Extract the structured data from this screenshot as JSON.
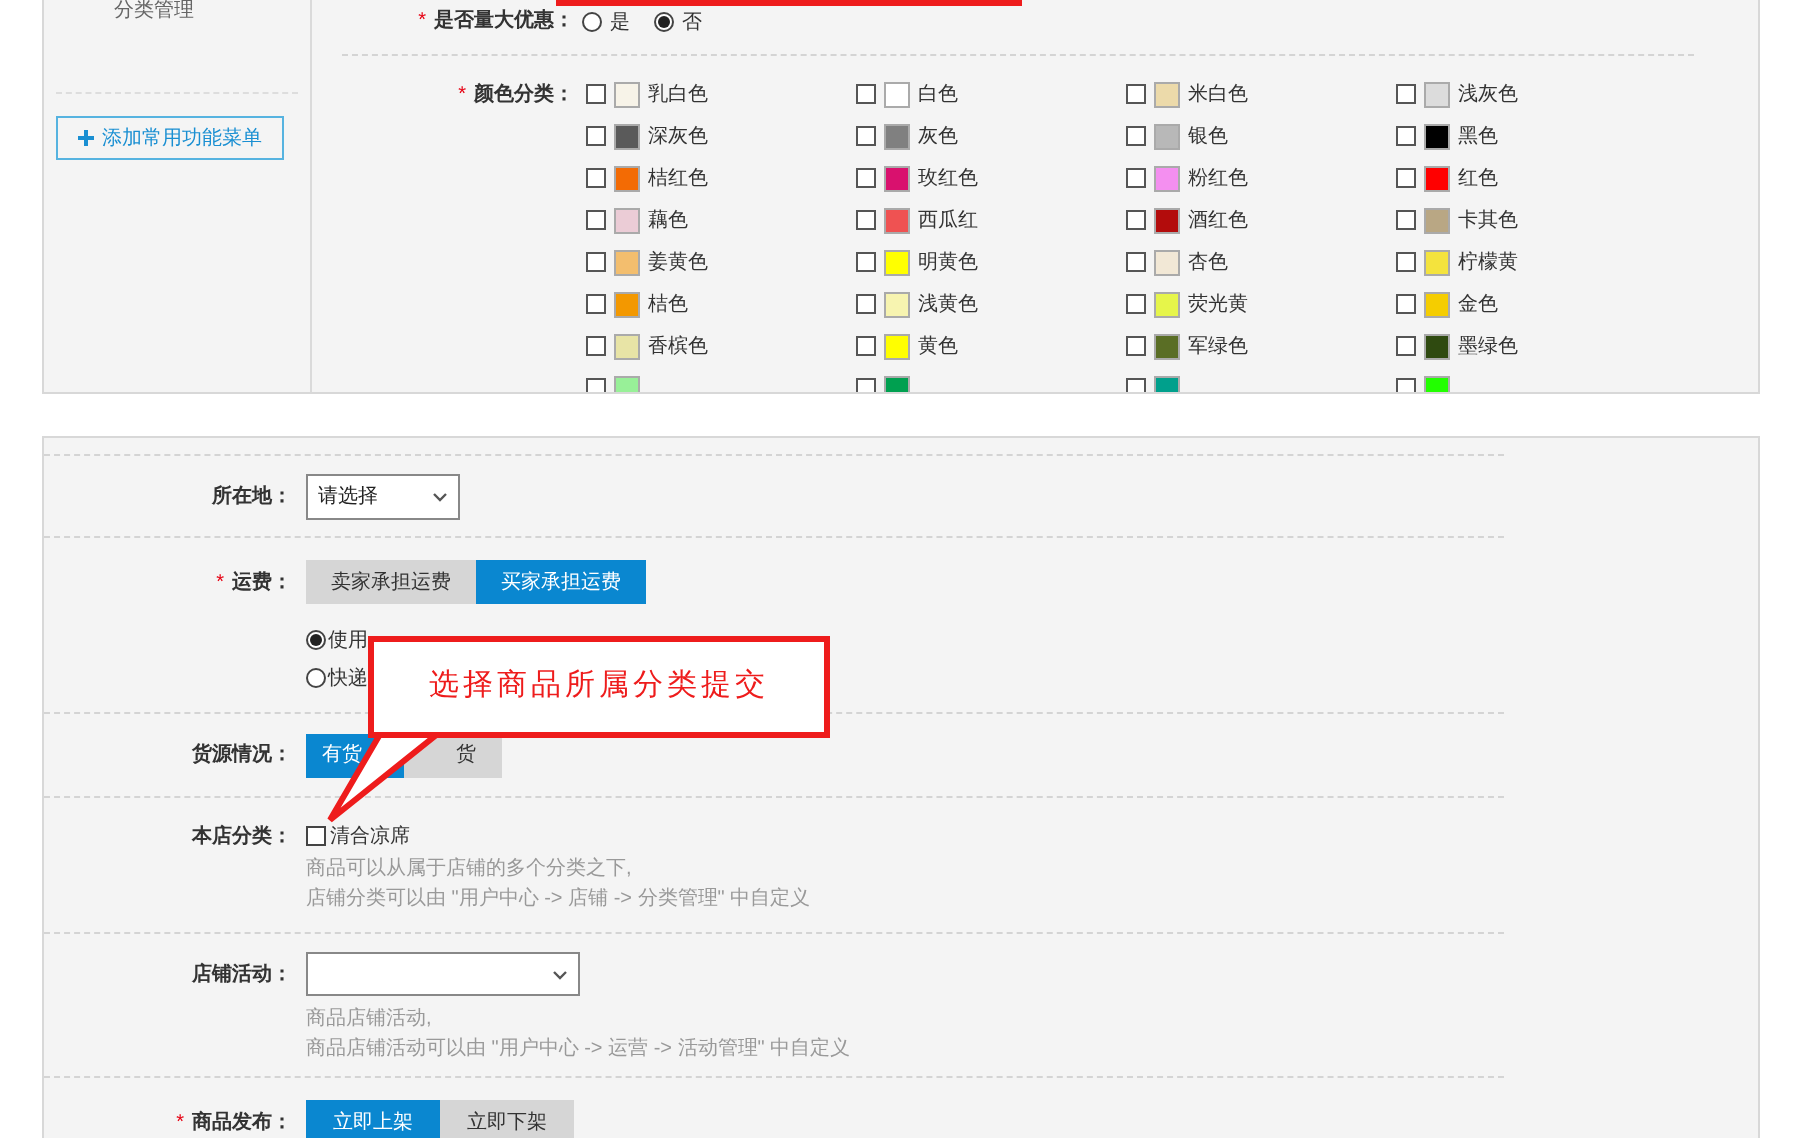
{
  "sidebar": {
    "items": [
      {
        "label": "分类管理"
      }
    ],
    "add_button": "添加常用功能菜单"
  },
  "discount": {
    "mark": "*",
    "label": "是否量大优惠：",
    "options": [
      {
        "label": "是",
        "selected": false
      },
      {
        "label": "否",
        "selected": true
      }
    ]
  },
  "colors": {
    "mark": "*",
    "label": "颜色分类：",
    "items": [
      {
        "name": "乳白色",
        "color": "#f7f3e8",
        "checked": false
      },
      {
        "name": "白色",
        "color": "#ffffff",
        "checked": false
      },
      {
        "name": "米白色",
        "color": "#ecdaaa",
        "checked": false
      },
      {
        "name": "浅灰色",
        "color": "#dcdcdc",
        "checked": false
      },
      {
        "name": "深灰色",
        "color": "#5a5a5a",
        "checked": false
      },
      {
        "name": "灰色",
        "color": "#808080",
        "checked": false
      },
      {
        "name": "银色",
        "color": "#b8b8b8",
        "checked": false
      },
      {
        "name": "黑色",
        "color": "#000000",
        "checked": false
      },
      {
        "name": "桔红色",
        "color": "#f36b04",
        "checked": false
      },
      {
        "name": "玫红色",
        "color": "#d9116e",
        "checked": false
      },
      {
        "name": "粉红色",
        "color": "#f48ff0",
        "checked": false
      },
      {
        "name": "红色",
        "color": "#ff0000",
        "checked": false
      },
      {
        "name": "藕色",
        "color": "#ebccd6",
        "checked": false
      },
      {
        "name": "西瓜红",
        "color": "#ef5252",
        "checked": false
      },
      {
        "name": "酒红色",
        "color": "#b30c0c",
        "checked": false
      },
      {
        "name": "卡其色",
        "color": "#b9a784",
        "checked": false
      },
      {
        "name": "姜黄色",
        "color": "#f3be6e",
        "checked": false
      },
      {
        "name": "明黄色",
        "color": "#ffff00",
        "checked": false
      },
      {
        "name": "杏色",
        "color": "#f2e8d6",
        "checked": false
      },
      {
        "name": "柠檬黄",
        "color": "#f4e33d",
        "checked": false
      },
      {
        "name": "桔色",
        "color": "#f39800",
        "checked": false
      },
      {
        "name": "浅黄色",
        "color": "#f7f4b0",
        "checked": false
      },
      {
        "name": "荧光黄",
        "color": "#e6f54a",
        "checked": false
      },
      {
        "name": "金色",
        "color": "#f5cd00",
        "checked": false
      },
      {
        "name": "香槟色",
        "color": "#e8e4a6",
        "checked": false
      },
      {
        "name": "黄色",
        "color": "#fffe00",
        "checked": false
      },
      {
        "name": "军绿色",
        "color": "#5a6e25",
        "checked": false
      },
      {
        "name": "墨绿色",
        "color": "#2f4a10",
        "checked": false
      },
      {
        "color": "#98f098",
        "checked": false
      },
      {
        "color": "#00a050",
        "checked": false
      },
      {
        "color": "#00a08c",
        "checked": false
      },
      {
        "color": "#22ff00",
        "checked": false
      }
    ]
  },
  "location": {
    "label": "所在地：",
    "value": "请选择"
  },
  "shipping": {
    "mark": "*",
    "label": "运费：",
    "options": [
      {
        "label": "卖家承担运费",
        "selected": false
      },
      {
        "label": "买家承担运费",
        "selected": true
      }
    ],
    "methods": [
      {
        "label": "使用",
        "selected": true
      },
      {
        "label": "快递",
        "selected": false
      }
    ]
  },
  "stock": {
    "label": "货源情况：",
    "options": [
      {
        "label": "有货",
        "selected": true
      },
      {
        "label": "货",
        "selected": false
      }
    ]
  },
  "shop_category": {
    "label": "本店分类：",
    "items": [
      {
        "label": "清合凉席",
        "checked": false
      }
    ],
    "hints": [
      "商品可以从属于店铺的多个分类之下,",
      "店铺分类可以由 \"用户中心 -> 店铺 -> 分类管理\" 中自定义"
    ]
  },
  "shop_activity": {
    "label": "店铺活动：",
    "hints": [
      "商品店铺活动,",
      "商品店铺活动可以由 \"用户中心 -> 运营 -> 活动管理\" 中自定义"
    ]
  },
  "publish": {
    "mark": "*",
    "label": "商品发布：",
    "options": [
      {
        "label": "立即上架",
        "selected": true
      },
      {
        "label": "立即下架",
        "selected": false
      }
    ]
  },
  "callout": {
    "text": "选择商品所属分类提交"
  }
}
